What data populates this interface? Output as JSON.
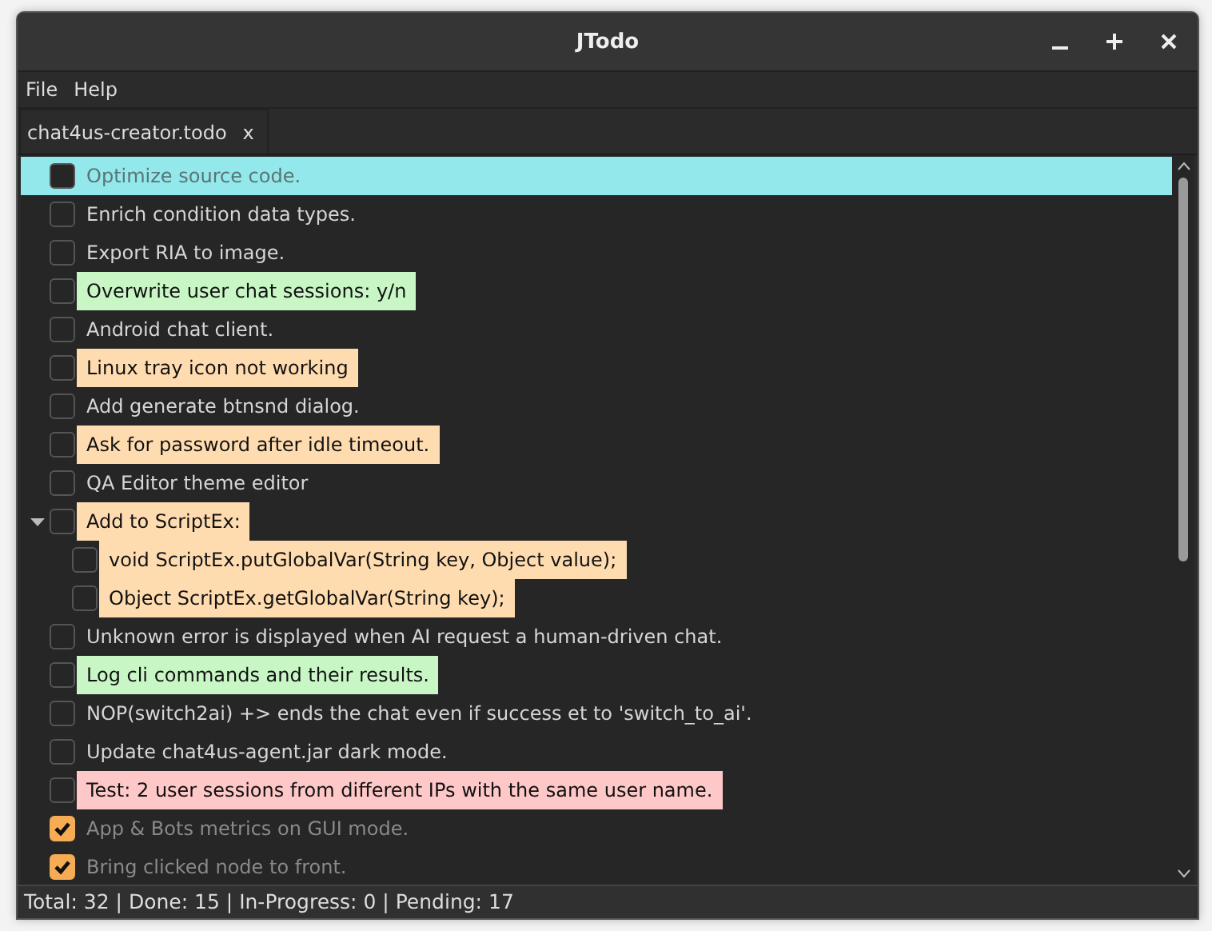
{
  "window": {
    "title": "JTodo"
  },
  "menu": [
    "File",
    "Help"
  ],
  "tabs": [
    {
      "label": "chat4us-creator.todo",
      "close": "x",
      "selected": true
    }
  ],
  "tasks": [
    {
      "text": "Optimize source code.",
      "checked": false,
      "selected": true
    },
    {
      "text": "Enrich condition data types.",
      "checked": false,
      "selected": false
    },
    {
      "text": "Export RIA to image.",
      "checked": false,
      "selected": false
    },
    {
      "text": "Overwrite user chat sessions: y/n",
      "checked": false,
      "selected": false,
      "color": "#c8f7c5"
    },
    {
      "text": "Android chat client.",
      "checked": false,
      "selected": false
    },
    {
      "text": "Linux tray icon not working",
      "checked": false,
      "selected": false,
      "color": "#ffdcb0"
    },
    {
      "text": "Add generate btnsnd dialog.",
      "checked": false,
      "selected": false
    },
    {
      "text": "Ask for password after idle timeout.",
      "checked": false,
      "selected": false,
      "color": "#ffdcb0"
    },
    {
      "text": "QA Editor theme editor",
      "checked": false,
      "selected": false
    },
    {
      "text": "Add to ScriptEx:",
      "checked": false,
      "selected": false,
      "color": "#ffdcb0",
      "expanded": true,
      "children": [
        {
          "text": "void ScriptEx.putGlobalVar(String key, Object value);",
          "checked": false,
          "selected": false,
          "color": "#ffdcb0"
        },
        {
          "text": "Object ScriptEx.getGlobalVar(String key);",
          "checked": false,
          "selected": false,
          "color": "#ffdcb0"
        }
      ]
    },
    {
      "text": "Unknown error is displayed when AI request a human-driven chat.",
      "checked": false,
      "selected": false
    },
    {
      "text": "Log cli commands and their results.",
      "checked": false,
      "selected": false,
      "color": "#c8f7c5"
    },
    {
      "text": "NOP(switch2ai) +> ends the chat even if success et to 'switch_to_ai'.",
      "checked": false,
      "selected": false
    },
    {
      "text": "Update chat4us-agent.jar dark mode.",
      "checked": false,
      "selected": false
    },
    {
      "text": "Test: 2 user sessions from different IPs with the same user name.",
      "checked": false,
      "selected": false,
      "color": "#ffc8c8"
    },
    {
      "text": "App & Bots metrics on GUI mode.",
      "checked": true,
      "selected": false
    },
    {
      "text": "Bring clicked node to front.",
      "checked": true,
      "selected": false
    }
  ],
  "status_bar": "Total: 32 | Done: 15 | In-Progress: 0 | Pending: 17"
}
